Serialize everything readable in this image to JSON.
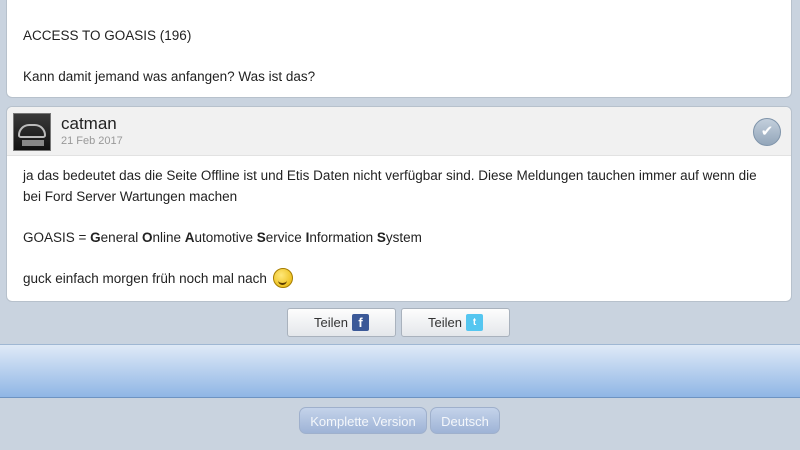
{
  "previous_post": {
    "line_top_fragment": "…",
    "line_access": "ACCESS TO GOASIS (196)",
    "line_question": "Kann damit jemand was anfangen? Was ist das?"
  },
  "post": {
    "author": "catman",
    "date": "21 Feb 2017",
    "like_icon": "checkmark-icon",
    "paragraph_1": "ja das bedeutet das die Seite Offline ist und Etis Daten nicht verfügbar sind. Diese Meldungen tauchen immer auf wenn die bei Ford Server Wartungen machen",
    "goasis_prefix": "GOASIS = ",
    "goasis_parts": [
      {
        "initial": "G",
        "rest": "eneral "
      },
      {
        "initial": "O",
        "rest": "nline "
      },
      {
        "initial": "A",
        "rest": "utomotive "
      },
      {
        "initial": "S",
        "rest": "ervice "
      },
      {
        "initial": "I",
        "rest": "nformation "
      },
      {
        "initial": "S",
        "rest": "ystem"
      }
    ],
    "paragraph_3": "guck einfach morgen früh noch mal nach",
    "smiley_icon": "wink-smiley-icon"
  },
  "share": {
    "facebook_label": "Teilen",
    "facebook_icon_glyph": "f",
    "twitter_label": "Teilen",
    "twitter_icon_glyph": "t"
  },
  "footer": {
    "full_version_label": "Komplette Version",
    "language_label": "Deutsch"
  }
}
